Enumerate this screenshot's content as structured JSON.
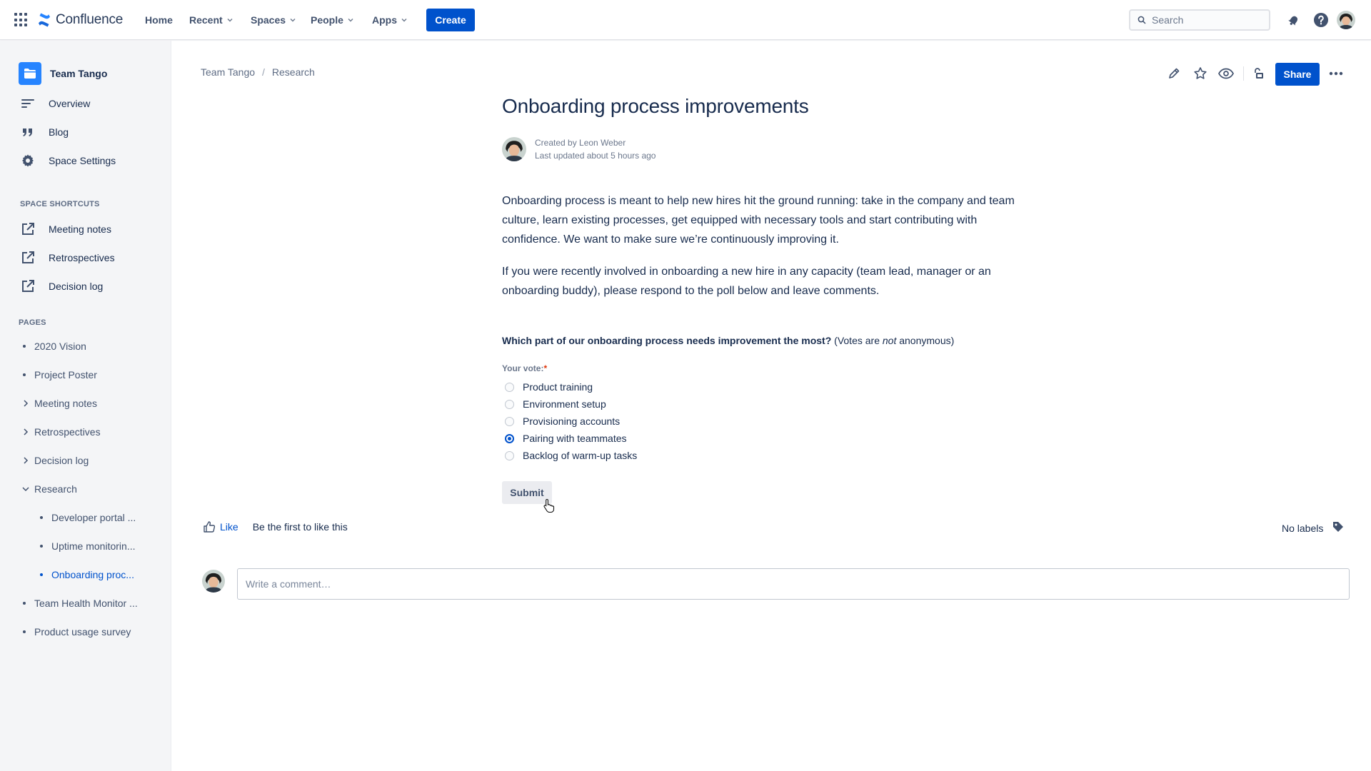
{
  "topnav": {
    "logo_text": "Confluence",
    "items": [
      {
        "label": "Home",
        "dropdown": false
      },
      {
        "label": "Recent",
        "dropdown": true
      },
      {
        "label": "Spaces",
        "dropdown": true
      },
      {
        "label": "People",
        "dropdown": true
      },
      {
        "label": "Apps",
        "dropdown": true
      }
    ],
    "create_label": "Create",
    "search_placeholder": "Search",
    "icons": [
      "app-switcher-icon",
      "notifications-icon",
      "help-icon",
      "profile-avatar"
    ]
  },
  "sidebar": {
    "space_name": "Team Tango",
    "main_items": [
      {
        "label": "Overview",
        "icon": "overview-icon"
      },
      {
        "label": "Blog",
        "icon": "quote-icon"
      },
      {
        "label": "Space Settings",
        "icon": "gear-icon"
      }
    ],
    "shortcuts_heading": "SPACE SHORTCUTS",
    "shortcuts": [
      {
        "label": "Meeting notes"
      },
      {
        "label": "Retrospectives"
      },
      {
        "label": "Decision log"
      }
    ],
    "pages_heading": "PAGES",
    "pages": [
      {
        "label": "2020 Vision",
        "type": "bullet",
        "level": 0
      },
      {
        "label": "Project Poster",
        "type": "bullet",
        "level": 0
      },
      {
        "label": "Meeting notes",
        "type": "collapsed",
        "level": 0
      },
      {
        "label": "Retrospectives",
        "type": "collapsed",
        "level": 0
      },
      {
        "label": "Decision log",
        "type": "collapsed",
        "level": 0
      },
      {
        "label": "Research",
        "type": "expanded",
        "level": 0
      },
      {
        "label": "Developer portal ...",
        "type": "bullet",
        "level": 1
      },
      {
        "label": "Uptime monitorin...",
        "type": "bullet",
        "level": 1
      },
      {
        "label": "Onboarding proc...",
        "type": "bullet",
        "level": 1,
        "active": true
      },
      {
        "label": "Team Health Monitor ...",
        "type": "bullet",
        "level": 0
      },
      {
        "label": "Product usage survey",
        "type": "bullet",
        "level": 0
      }
    ]
  },
  "breadcrumb": [
    "Team Tango",
    "Research"
  ],
  "page_actions": {
    "share_label": "Share",
    "icons": [
      "edit-icon",
      "star-icon",
      "watch-icon",
      "restrictions-icon",
      "more-icon"
    ]
  },
  "page": {
    "title": "Onboarding process improvements",
    "created_by": "Created by Leon Weber",
    "last_updated": "Last updated about 5 hours ago",
    "paragraph1": "Onboarding process is meant to help new hires hit the ground running: take in the company and team culture, learn existing processes, get equipped with necessary tools and start contributing with confidence. We want to make sure we’re continuously improving it.",
    "paragraph2": "If you were recently involved in onboarding a new hire in any capacity (team lead, manager or an onboarding buddy), please respond to the poll below and leave comments."
  },
  "poll": {
    "question": "Which part of our onboarding process needs improvement the most?",
    "note_before": "(Votes are ",
    "note_em": "not",
    "note_after": " anonymous)",
    "vote_label": "Your vote:",
    "required_mark": "*",
    "options": [
      {
        "label": "Product training",
        "selected": false
      },
      {
        "label": "Environment setup",
        "selected": false
      },
      {
        "label": "Provisioning accounts",
        "selected": false
      },
      {
        "label": "Pairing with teammates",
        "selected": true
      },
      {
        "label": "Backlog of warm-up tasks",
        "selected": false
      }
    ],
    "submit_label": "Submit"
  },
  "footer": {
    "like_label": "Like",
    "like_text": "Be the first to like this",
    "labels_text": "No labels",
    "comment_placeholder": "Write a comment…"
  },
  "colors": {
    "brand_blue": "#0052cc",
    "sidebar_bg": "#f4f5f7",
    "space_logo": "#2684ff",
    "text_primary": "#172b4d",
    "text_secondary": "#6b778c"
  }
}
